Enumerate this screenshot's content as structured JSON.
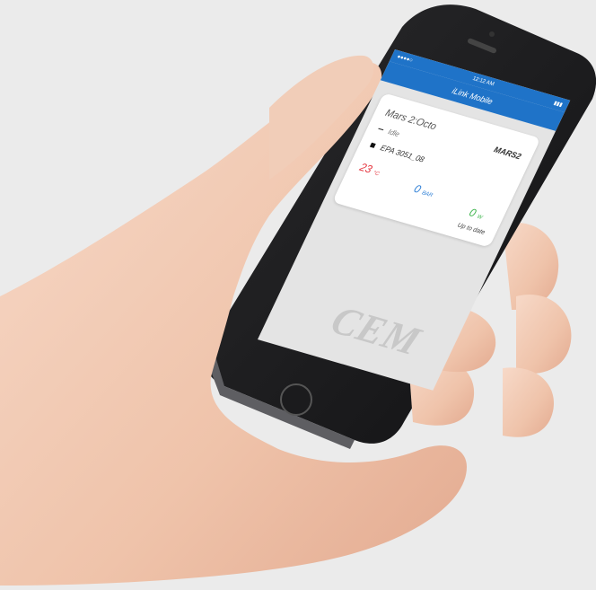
{
  "app": {
    "status_time": "12:12 AM",
    "title": "iLink Mobile"
  },
  "instrument_card": {
    "name": "Mars 2:Octo",
    "logo_text": "MARS2",
    "state": "Idle",
    "method": "EPA 3051_08",
    "temperature": {
      "value": "23",
      "unit": "°C"
    },
    "pressure": {
      "value": "0",
      "unit": "BAR"
    },
    "power": {
      "value": "0",
      "unit": "W"
    },
    "sync_status": "Up to date"
  },
  "brand_watermark": "CEM",
  "colors": {
    "header_blue": "#1f73c8",
    "temperature_red": "#e5353f",
    "pressure_blue": "#2d7fd6",
    "power_green": "#3cb44b"
  }
}
